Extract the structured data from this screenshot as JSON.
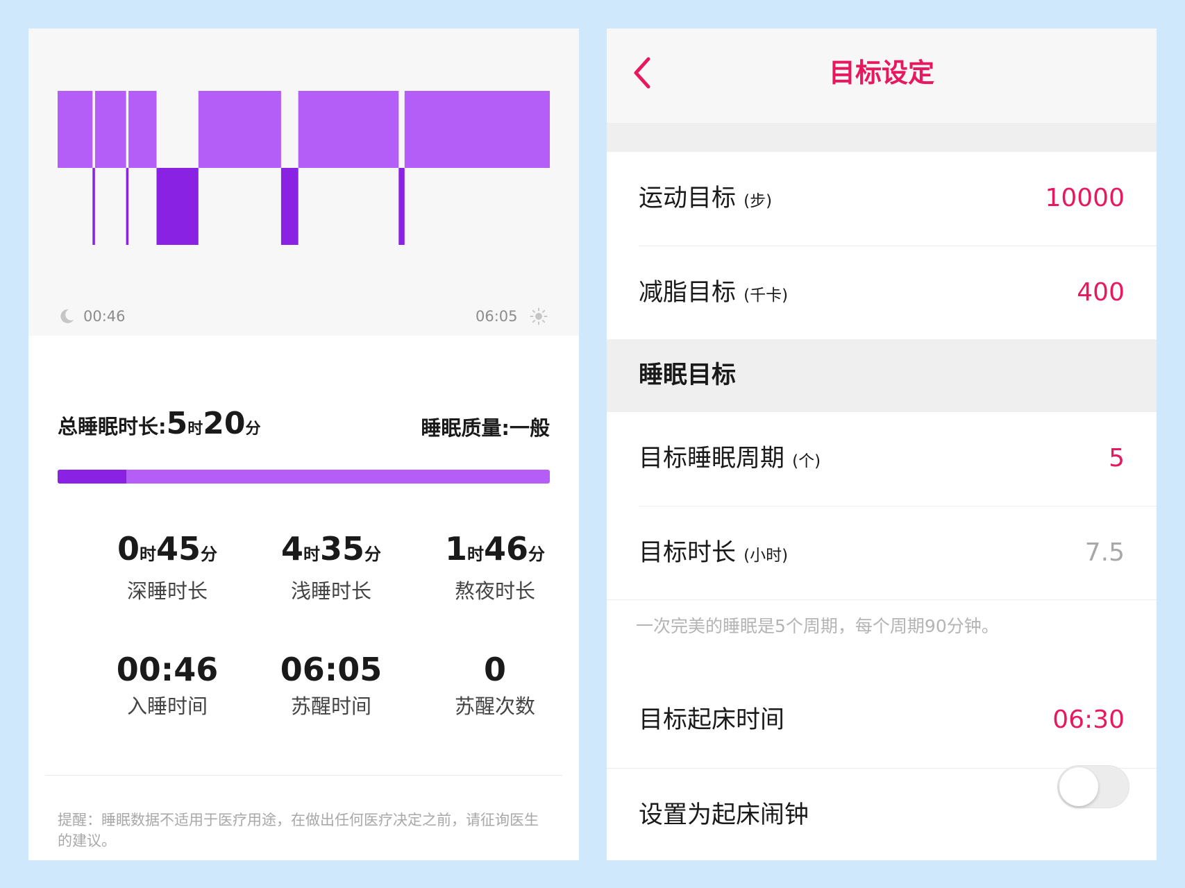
{
  "sleep_report": {
    "chart": {
      "start_label": "00:46",
      "end_label": "06:05",
      "light_color": "#b55df7",
      "deep_color": "#8a22e3",
      "segments": [
        {
          "stage": "light",
          "from": 0.0,
          "to": 0.071
        },
        {
          "stage": "deep",
          "from": 0.071,
          "to": 0.076
        },
        {
          "stage": "light",
          "from": 0.076,
          "to": 0.139
        },
        {
          "stage": "deep",
          "from": 0.139,
          "to": 0.144
        },
        {
          "stage": "light",
          "from": 0.144,
          "to": 0.201
        },
        {
          "stage": "deep",
          "from": 0.201,
          "to": 0.286
        },
        {
          "stage": "light",
          "from": 0.286,
          "to": 0.454
        },
        {
          "stage": "deep",
          "from": 0.454,
          "to": 0.489
        },
        {
          "stage": "light",
          "from": 0.489,
          "to": 0.693
        },
        {
          "stage": "deep",
          "from": 0.693,
          "to": 0.705
        },
        {
          "stage": "light",
          "from": 0.705,
          "to": 1.0
        }
      ]
    },
    "total": {
      "prefix": "总睡眠时长:",
      "hours": "5",
      "hour_unit": "时",
      "minutes": "20",
      "minute_unit": "分"
    },
    "quality": "睡眠质量:一般",
    "deep_fraction": 0.14,
    "stats": {
      "deep": {
        "hours": "0",
        "minutes": "45",
        "label": "深睡时长"
      },
      "light": {
        "hours": "4",
        "minutes": "35",
        "label": "浅睡时长"
      },
      "late": {
        "hours": "1",
        "minutes": "46",
        "label": "熬夜时长"
      },
      "bedtime": {
        "value": "00:46",
        "label": "入睡时间"
      },
      "wake_time": {
        "value": "06:05",
        "label": "苏醒时间"
      },
      "wake_count": {
        "value": "0",
        "label": "苏醒次数"
      },
      "hour_unit": "时",
      "minute_unit": "分"
    },
    "disclaimer": "提醒：睡眠数据不适用于医疗用途，在做出任何医疗决定之前，请征询医生的建议。"
  },
  "goal_settings": {
    "title": "目标设定",
    "accent_color": "#e8185e",
    "exercise": {
      "label": "运动目标",
      "unit": "(步)",
      "value": "10000"
    },
    "fat_burn": {
      "label": "减脂目标",
      "unit": "(千卡)",
      "value": "400"
    },
    "sleep_section": "睡眠目标",
    "sleep_cycles": {
      "label": "目标睡眠周期",
      "unit": "(个)",
      "value": "5"
    },
    "sleep_duration": {
      "label": "目标时长",
      "unit": "(小时)",
      "value": "7.5"
    },
    "hint": "一次完美的睡眠是5个周期，每个周期90分钟。",
    "wake_time": {
      "label": "目标起床时间",
      "value": "06:30"
    },
    "alarm": {
      "label": "设置为起床闹钟",
      "enabled": false
    }
  }
}
